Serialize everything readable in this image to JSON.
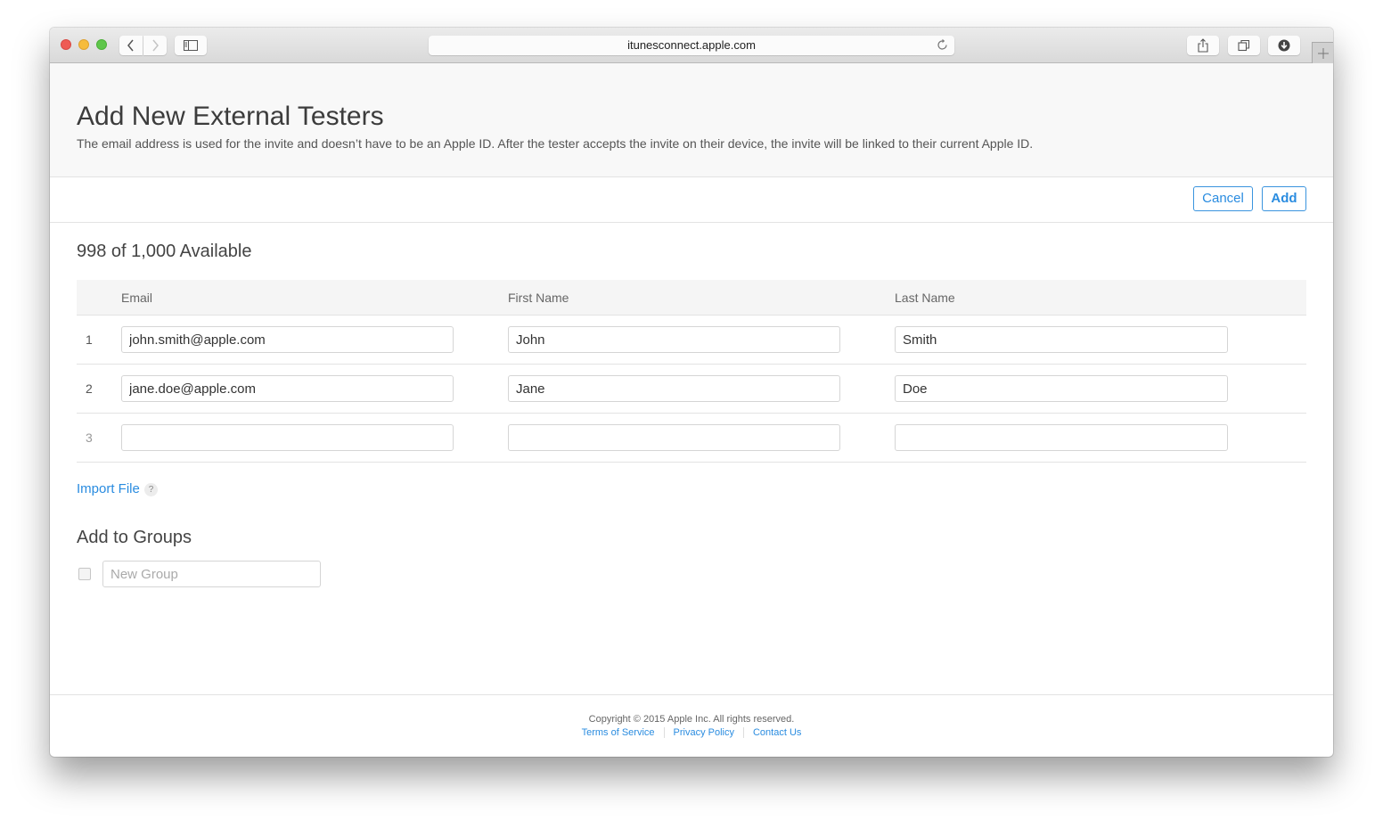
{
  "browser": {
    "url": "itunesconnect.apple.com",
    "icons": {
      "back": "chevron-left-icon",
      "forward": "chevron-right-icon",
      "sidebar": "sidebar-icon",
      "reload": "reload-icon",
      "share": "share-icon",
      "tabs": "tabs-icon",
      "downloads": "download-icon",
      "new_tab": "plus-icon"
    }
  },
  "header": {
    "title": "Add New External Testers",
    "description": "The email address is used for the invite and doesn’t have to be an Apple ID. After the tester accepts the invite on their device, the invite will be linked to their current Apple ID."
  },
  "actions": {
    "cancel_label": "Cancel",
    "add_label": "Add"
  },
  "availability": "998 of 1,000 Available",
  "table": {
    "columns": [
      "Email",
      "First Name",
      "Last Name"
    ],
    "rows": [
      {
        "num": "1",
        "email": "john.smith@apple.com",
        "first": "John",
        "last": "Smith"
      },
      {
        "num": "2",
        "email": "jane.doe@apple.com",
        "first": "Jane",
        "last": "Doe"
      },
      {
        "num": "3",
        "email": "",
        "first": "",
        "last": ""
      }
    ]
  },
  "import": {
    "label": "Import File",
    "help": "?"
  },
  "groups": {
    "title": "Add to Groups",
    "new_group_placeholder": "New Group",
    "new_group_checked": false
  },
  "footer": {
    "copyright": "Copyright © 2015 Apple Inc. All rights reserved.",
    "links": [
      "Terms of Service",
      "Privacy Policy",
      "Contact Us"
    ]
  },
  "colors": {
    "accent": "#2a8ce0",
    "header_bg": "#f8f8f8",
    "table_header_bg": "#f5f5f5"
  }
}
